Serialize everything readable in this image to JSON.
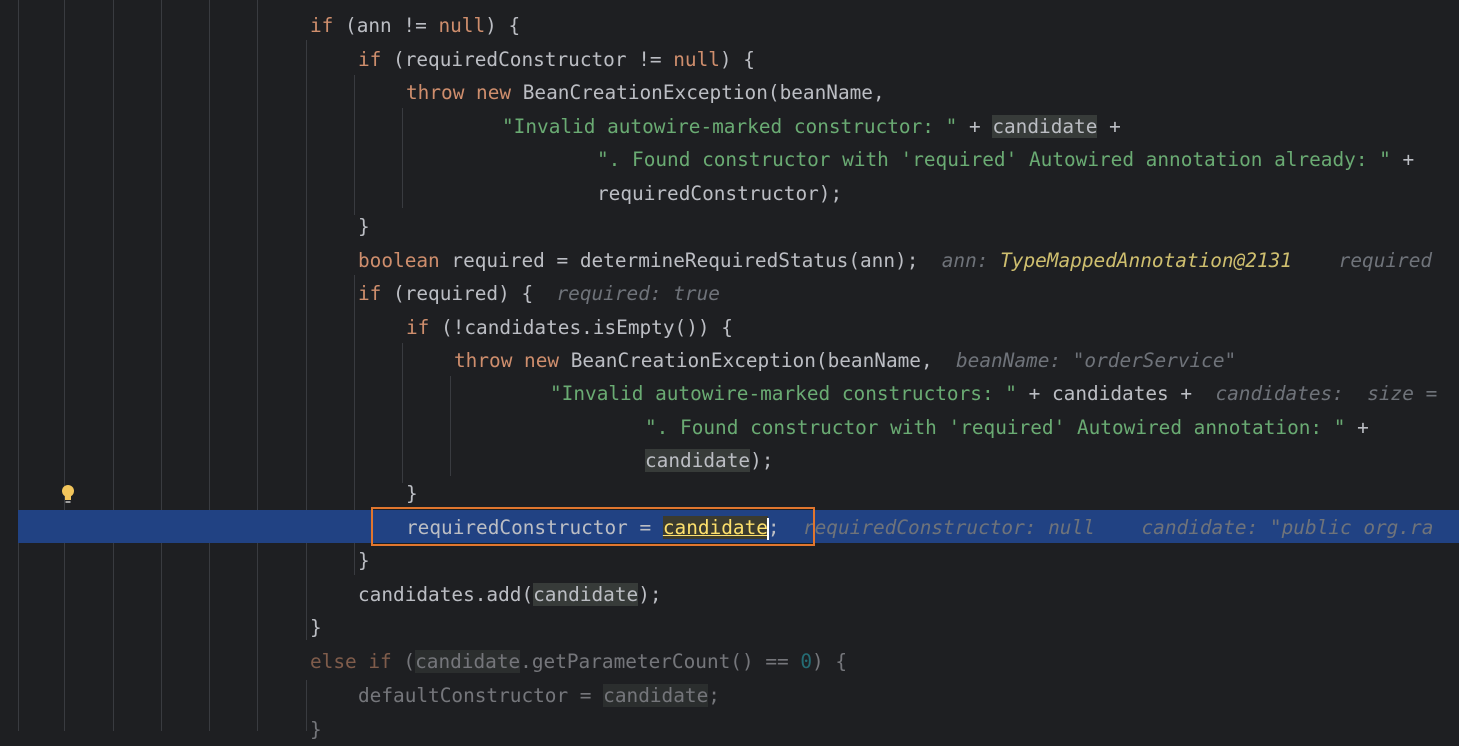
{
  "editor": {
    "lines": [
      {
        "id": "l1",
        "parts": [
          {
            "t": "if",
            "c": "kw"
          },
          {
            "t": " (ann != "
          },
          {
            "t": "null",
            "c": "kw"
          },
          {
            "t": ") {"
          }
        ]
      },
      {
        "id": "l2",
        "parts": [
          {
            "t": "if",
            "c": "kw"
          },
          {
            "t": " (requiredConstructor != "
          },
          {
            "t": "null",
            "c": "kw"
          },
          {
            "t": ") {"
          }
        ]
      },
      {
        "id": "l3",
        "parts": [
          {
            "t": "throw new",
            "c": "kw"
          },
          {
            "t": " BeanCreationException(beanName,"
          }
        ]
      },
      {
        "id": "l4",
        "parts": [
          {
            "t": "\"Invalid autowire-marked constructor: \"",
            "c": "str"
          },
          {
            "t": " + "
          },
          {
            "t": "candidate",
            "c": "hlvar"
          },
          {
            "t": " +"
          }
        ]
      },
      {
        "id": "l5",
        "parts": [
          {
            "t": "\". Found constructor with 'required' Autowired annotation already: \"",
            "c": "str"
          },
          {
            "t": " +"
          }
        ]
      },
      {
        "id": "l6",
        "parts": [
          {
            "t": "requiredConstructor);"
          }
        ]
      },
      {
        "id": "l7",
        "parts": [
          {
            "t": "}"
          }
        ]
      },
      {
        "id": "l8",
        "parts": [
          {
            "t": "boolean",
            "c": "kw"
          },
          {
            "t": " required = determineRequiredStatus(ann);"
          },
          {
            "t": "  ann: ",
            "c": "hint"
          },
          {
            "t": "TypeMappedAnnotation@2131",
            "c": "hintv"
          },
          {
            "t": "    required",
            "c": "hint"
          }
        ]
      },
      {
        "id": "l9",
        "parts": [
          {
            "t": "if",
            "c": "kw"
          },
          {
            "t": " (required) {"
          },
          {
            "t": "  required: true",
            "c": "hint"
          }
        ]
      },
      {
        "id": "l10",
        "parts": [
          {
            "t": "if",
            "c": "kw"
          },
          {
            "t": " (!candidates.isEmpty()) {"
          }
        ]
      },
      {
        "id": "l11",
        "parts": [
          {
            "t": "throw new",
            "c": "kw"
          },
          {
            "t": " BeanCreationException(beanName,"
          },
          {
            "t": "  beanName: \"orderService\"",
            "c": "hint"
          }
        ]
      },
      {
        "id": "l12",
        "parts": [
          {
            "t": "\"Invalid autowire-marked constructors: \"",
            "c": "str"
          },
          {
            "t": " + candidates +"
          },
          {
            "t": "  candidates:  size =",
            "c": "hint"
          }
        ]
      },
      {
        "id": "l13",
        "parts": [
          {
            "t": "\". Found constructor with 'required' Autowired annotation: \"",
            "c": "str"
          },
          {
            "t": " +"
          }
        ]
      },
      {
        "id": "l14",
        "parts": [
          {
            "t": "candidate",
            "c": "hlvar"
          },
          {
            "t": ");"
          }
        ]
      },
      {
        "id": "l15",
        "parts": [
          {
            "t": "}"
          }
        ]
      },
      {
        "id": "l16",
        "parts": [
          {
            "t": "requiredConstructor = "
          },
          {
            "t": "candidate",
            "c": "caretword"
          },
          {
            "t": "|",
            "c": "caret"
          },
          {
            "t": ";"
          },
          {
            "t": "  requiredConstructor: null    candidate: \"public org.ra",
            "c": "hint"
          }
        ]
      },
      {
        "id": "l17",
        "parts": [
          {
            "t": "}"
          }
        ]
      },
      {
        "id": "l18",
        "parts": [
          {
            "t": "candidates.add("
          },
          {
            "t": "candidate",
            "c": "hlvar"
          },
          {
            "t": ");"
          }
        ]
      },
      {
        "id": "l19",
        "parts": [
          {
            "t": "}"
          }
        ]
      },
      {
        "id": "l20",
        "parts": [
          {
            "t": "else if",
            "c": "kw dim"
          },
          {
            "t": " (",
            "c": "dim"
          },
          {
            "t": "candidate",
            "c": "hlvar dim"
          },
          {
            "t": ".getParameterCount() == ",
            "c": "dim"
          },
          {
            "t": "0",
            "c": "num dim"
          },
          {
            "t": ") {",
            "c": "dim"
          }
        ]
      },
      {
        "id": "l21",
        "parts": [
          {
            "t": "defaultConstructor = ",
            "c": "dim"
          },
          {
            "t": "candidate",
            "c": "hlvar dim"
          },
          {
            "t": ";",
            "c": "dim"
          }
        ]
      },
      {
        "id": "l22",
        "parts": [
          {
            "t": "}",
            "c": "dim"
          }
        ]
      }
    ]
  },
  "colors": {
    "background": "#1e1f22",
    "execution_line": "#214283",
    "focus_border": "#e1762e",
    "keyword": "#cf8e6d",
    "string": "#6aab73"
  },
  "icons": {
    "bulb": "lightbulb-icon"
  }
}
